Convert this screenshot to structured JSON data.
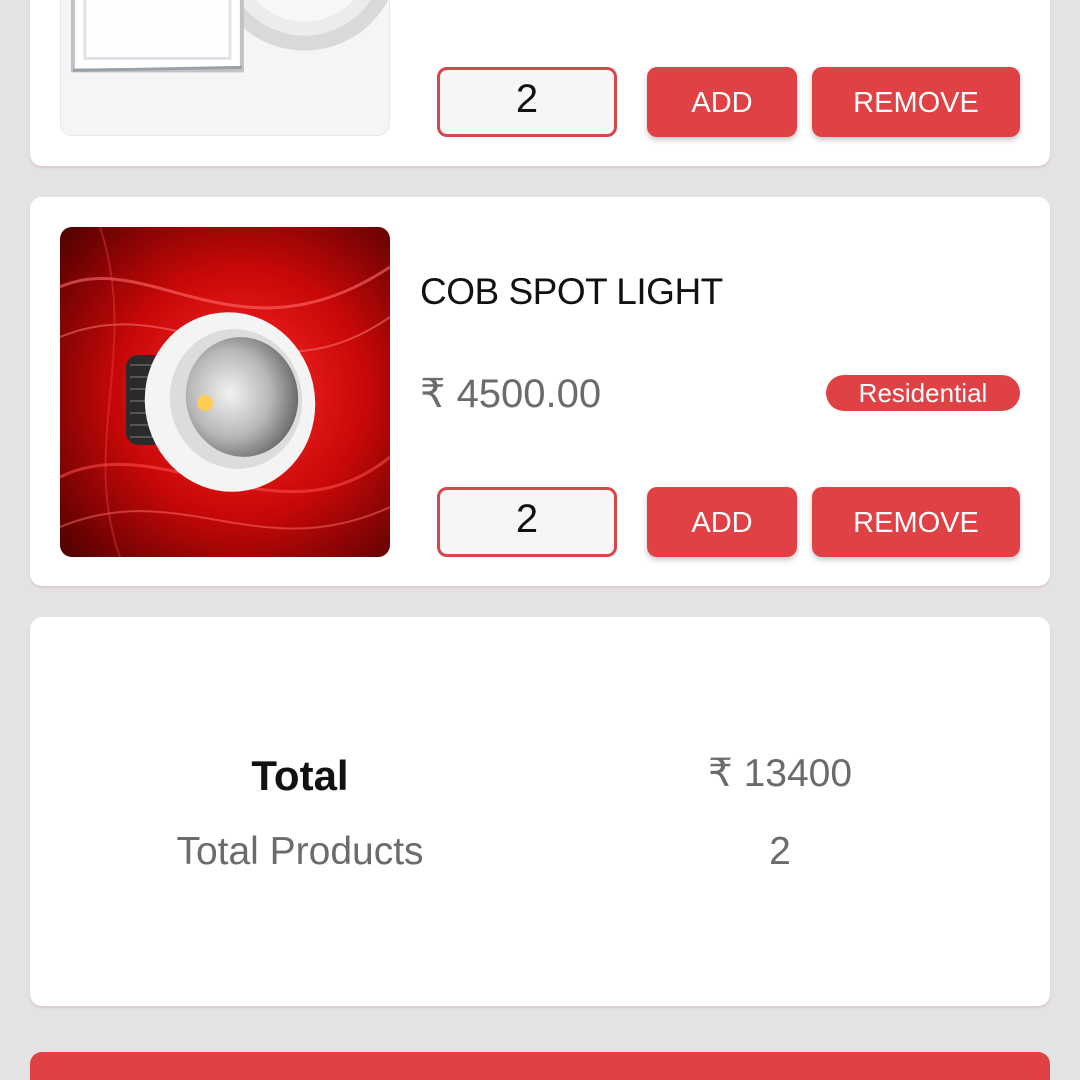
{
  "colors": {
    "accent": "#e04145",
    "background": "#e3e3e3",
    "card": "#ffffff",
    "muted_text": "#6b6b6b"
  },
  "cart_items": [
    {
      "image_icon": "square-round-panel-light-image",
      "quantity": "2",
      "add_label": "ADD",
      "remove_label": "REMOVE"
    },
    {
      "image_icon": "cob-spot-light-image",
      "name": "COB SPOT LIGHT",
      "price": "₹ 4500.00",
      "category": "Residential",
      "quantity": "2",
      "add_label": "ADD",
      "remove_label": "REMOVE"
    }
  ],
  "summary": {
    "total_label": "Total",
    "total_value": "₹ 13400",
    "products_label": "Total Products",
    "products_value": "2"
  }
}
